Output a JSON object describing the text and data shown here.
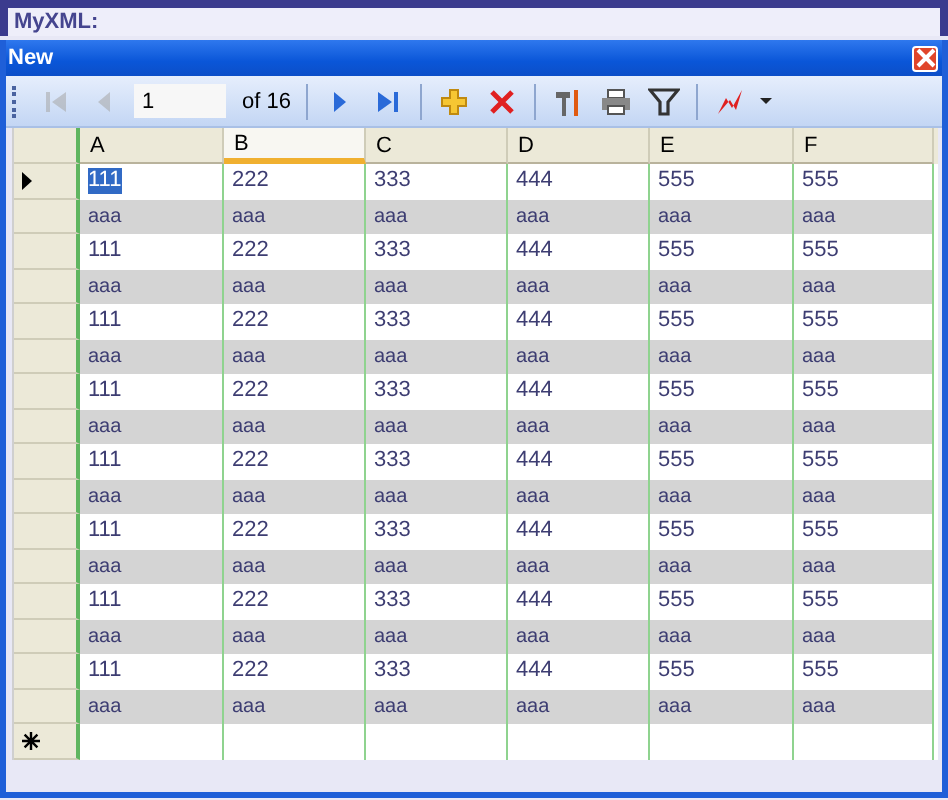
{
  "app_bar": {
    "label": "MyXML:"
  },
  "window": {
    "title": "New"
  },
  "toolbar": {
    "items": [
      {
        "kind": "first",
        "disabled": true
      },
      {
        "kind": "prev",
        "disabled": true
      },
      {
        "kind": "position",
        "value": "1"
      },
      {
        "kind": "count",
        "text": "of 16"
      },
      {
        "kind": "sep"
      },
      {
        "kind": "next",
        "disabled": false
      },
      {
        "kind": "last",
        "disabled": false
      },
      {
        "kind": "sep"
      },
      {
        "kind": "add",
        "disabled": false
      },
      {
        "kind": "delete",
        "disabled": false
      },
      {
        "kind": "sep"
      },
      {
        "kind": "tools",
        "disabled": false
      },
      {
        "kind": "print",
        "disabled": false
      },
      {
        "kind": "filter",
        "disabled": false
      },
      {
        "kind": "sep"
      },
      {
        "kind": "chart",
        "disabled": false
      },
      {
        "kind": "caret",
        "disabled": false
      }
    ]
  },
  "grid": {
    "columns": [
      {
        "label": "A",
        "hovered": false
      },
      {
        "label": "B",
        "hovered": true
      },
      {
        "label": "C",
        "hovered": false
      },
      {
        "label": "D",
        "hovered": false
      },
      {
        "label": "E",
        "hovered": false
      },
      {
        "label": "F",
        "hovered": false
      }
    ],
    "rows": [
      {
        "current": true,
        "shaded": false,
        "cells": [
          {
            "text": "111",
            "selected": true
          },
          {
            "text": "222",
            "selected": false
          },
          {
            "text": "333",
            "selected": false
          },
          {
            "text": "444",
            "selected": false
          },
          {
            "text": "555",
            "selected": false
          },
          {
            "text": "555",
            "selected": false
          }
        ]
      },
      {
        "current": false,
        "shaded": true,
        "cells": [
          {
            "text": "aaa",
            "selected": false
          },
          {
            "text": "aaa",
            "selected": false
          },
          {
            "text": "aaa",
            "selected": false
          },
          {
            "text": "aaa",
            "selected": false
          },
          {
            "text": "aaa",
            "selected": false
          },
          {
            "text": "aaa",
            "selected": false
          }
        ]
      },
      {
        "current": false,
        "shaded": false,
        "cells": [
          {
            "text": "111",
            "selected": false
          },
          {
            "text": "222",
            "selected": false
          },
          {
            "text": "333",
            "selected": false
          },
          {
            "text": "444",
            "selected": false
          },
          {
            "text": "555",
            "selected": false
          },
          {
            "text": "555",
            "selected": false
          }
        ]
      },
      {
        "current": false,
        "shaded": true,
        "cells": [
          {
            "text": "aaa",
            "selected": false
          },
          {
            "text": "aaa",
            "selected": false
          },
          {
            "text": "aaa",
            "selected": false
          },
          {
            "text": "aaa",
            "selected": false
          },
          {
            "text": "aaa",
            "selected": false
          },
          {
            "text": "aaa",
            "selected": false
          }
        ]
      },
      {
        "current": false,
        "shaded": false,
        "cells": [
          {
            "text": "111",
            "selected": false
          },
          {
            "text": "222",
            "selected": false
          },
          {
            "text": "333",
            "selected": false
          },
          {
            "text": "444",
            "selected": false
          },
          {
            "text": "555",
            "selected": false
          },
          {
            "text": "555",
            "selected": false
          }
        ]
      },
      {
        "current": false,
        "shaded": true,
        "cells": [
          {
            "text": "aaa",
            "selected": false
          },
          {
            "text": "aaa",
            "selected": false
          },
          {
            "text": "aaa",
            "selected": false
          },
          {
            "text": "aaa",
            "selected": false
          },
          {
            "text": "aaa",
            "selected": false
          },
          {
            "text": "aaa",
            "selected": false
          }
        ]
      },
      {
        "current": false,
        "shaded": false,
        "cells": [
          {
            "text": "111",
            "selected": false
          },
          {
            "text": "222",
            "selected": false
          },
          {
            "text": "333",
            "selected": false
          },
          {
            "text": "444",
            "selected": false
          },
          {
            "text": "555",
            "selected": false
          },
          {
            "text": "555",
            "selected": false
          }
        ]
      },
      {
        "current": false,
        "shaded": true,
        "cells": [
          {
            "text": "aaa",
            "selected": false
          },
          {
            "text": "aaa",
            "selected": false
          },
          {
            "text": "aaa",
            "selected": false
          },
          {
            "text": "aaa",
            "selected": false
          },
          {
            "text": "aaa",
            "selected": false
          },
          {
            "text": "aaa",
            "selected": false
          }
        ]
      },
      {
        "current": false,
        "shaded": false,
        "cells": [
          {
            "text": "111",
            "selected": false
          },
          {
            "text": "222",
            "selected": false
          },
          {
            "text": "333",
            "selected": false
          },
          {
            "text": "444",
            "selected": false
          },
          {
            "text": "555",
            "selected": false
          },
          {
            "text": "555",
            "selected": false
          }
        ]
      },
      {
        "current": false,
        "shaded": true,
        "cells": [
          {
            "text": "aaa",
            "selected": false
          },
          {
            "text": "aaa",
            "selected": false
          },
          {
            "text": "aaa",
            "selected": false
          },
          {
            "text": "aaa",
            "selected": false
          },
          {
            "text": "aaa",
            "selected": false
          },
          {
            "text": "aaa",
            "selected": false
          }
        ]
      },
      {
        "current": false,
        "shaded": false,
        "cells": [
          {
            "text": "111",
            "selected": false
          },
          {
            "text": "222",
            "selected": false
          },
          {
            "text": "333",
            "selected": false
          },
          {
            "text": "444",
            "selected": false
          },
          {
            "text": "555",
            "selected": false
          },
          {
            "text": "555",
            "selected": false
          }
        ]
      },
      {
        "current": false,
        "shaded": true,
        "cells": [
          {
            "text": "aaa",
            "selected": false
          },
          {
            "text": "aaa",
            "selected": false
          },
          {
            "text": "aaa",
            "selected": false
          },
          {
            "text": "aaa",
            "selected": false
          },
          {
            "text": "aaa",
            "selected": false
          },
          {
            "text": "aaa",
            "selected": false
          }
        ]
      },
      {
        "current": false,
        "shaded": false,
        "cells": [
          {
            "text": "111",
            "selected": false
          },
          {
            "text": "222",
            "selected": false
          },
          {
            "text": "333",
            "selected": false
          },
          {
            "text": "444",
            "selected": false
          },
          {
            "text": "555",
            "selected": false
          },
          {
            "text": "555",
            "selected": false
          }
        ]
      },
      {
        "current": false,
        "shaded": true,
        "cells": [
          {
            "text": "aaa",
            "selected": false
          },
          {
            "text": "aaa",
            "selected": false
          },
          {
            "text": "aaa",
            "selected": false
          },
          {
            "text": "aaa",
            "selected": false
          },
          {
            "text": "aaa",
            "selected": false
          },
          {
            "text": "aaa",
            "selected": false
          }
        ]
      },
      {
        "current": false,
        "shaded": false,
        "cells": [
          {
            "text": "111",
            "selected": false
          },
          {
            "text": "222",
            "selected": false
          },
          {
            "text": "333",
            "selected": false
          },
          {
            "text": "444",
            "selected": false
          },
          {
            "text": "555",
            "selected": false
          },
          {
            "text": "555",
            "selected": false
          }
        ]
      },
      {
        "current": false,
        "shaded": true,
        "cells": [
          {
            "text": "aaa",
            "selected": false
          },
          {
            "text": "aaa",
            "selected": false
          },
          {
            "text": "aaa",
            "selected": false
          },
          {
            "text": "aaa",
            "selected": false
          },
          {
            "text": "aaa",
            "selected": false
          },
          {
            "text": "aaa",
            "selected": false
          }
        ]
      }
    ],
    "new_row": true
  }
}
